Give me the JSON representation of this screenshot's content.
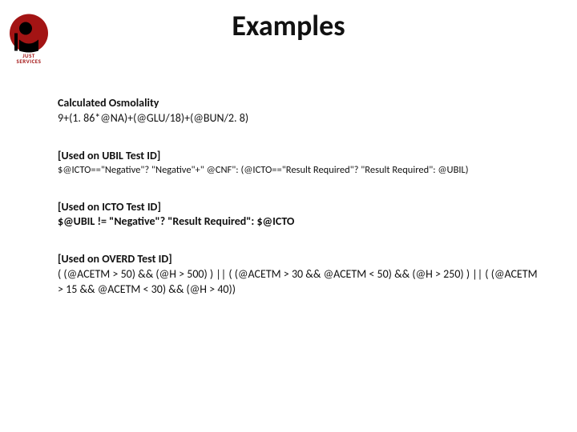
{
  "logo": {
    "top": "JUST",
    "bottom": "SERVICES"
  },
  "title": "Examples",
  "sections": [
    {
      "heading": "Calculated Osmolality",
      "body": "9+(1. 86*@NA)+(@GLU/18)+(@BUN/2. 8)",
      "body_small": false
    },
    {
      "heading": "[Used on UBIL Test ID]",
      "body": "$@ICTO==\"Negative\"? \"Negative\"+\" @CNF\": (@ICTO==\"Result Required\"? \"Result Required\": @UBIL)",
      "body_small": true
    },
    {
      "heading": "[Used on ICTO Test ID]",
      "body": "$@UBIL != \"Negative\"? \"Result Required\": $@ICTO",
      "body_small": false,
      "body_bold": true
    },
    {
      "heading": "[Used on OVERD Test ID]",
      "body": "( (@ACETM > 50) && (@H > 500) ) || ( (@ACETM > 30 && @ACETM < 50) && (@H > 250) ) || ( (@ACETM > 15 && @ACETM < 30) && (@H > 40))",
      "body_small": false
    }
  ]
}
